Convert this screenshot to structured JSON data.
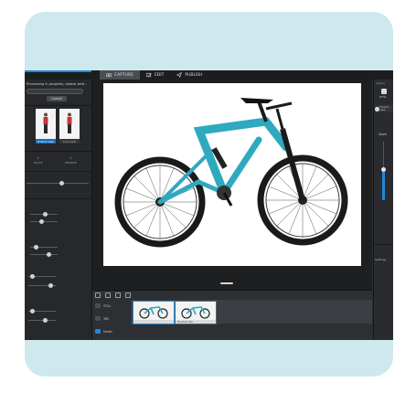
{
  "app": {
    "tabs": [
      {
        "label": "CAPTURE"
      },
      {
        "label": "EDIT"
      },
      {
        "label": "PUBLISH"
      }
    ]
  },
  "left_panel": {
    "progress_text": "Processing in progress, please wait...",
    "cancel_label": "Cancel",
    "thumb1_tag": "Product view",
    "thumb2_tag": "Look view",
    "tool1_label": "PLACE",
    "tool2_label": "REMOVE"
  },
  "bottom_panel": {
    "items": [
      {
        "label": "STILL"
      },
      {
        "label": "360"
      },
      {
        "label": "Model"
      }
    ],
    "frames": [
      {
        "caption": ""
      },
      {
        "caption": "Mountain bike"
      }
    ]
  },
  "right_panel": {
    "tab": "Layers",
    "still_label": "STILL",
    "user_label": "Product view",
    "zoom_label": "Zoom",
    "footer_label": "Settings"
  },
  "colors": {
    "accent": "#1e88d8",
    "bike_frame": "#2ea9bf",
    "card_bg": "#cde9ee"
  }
}
